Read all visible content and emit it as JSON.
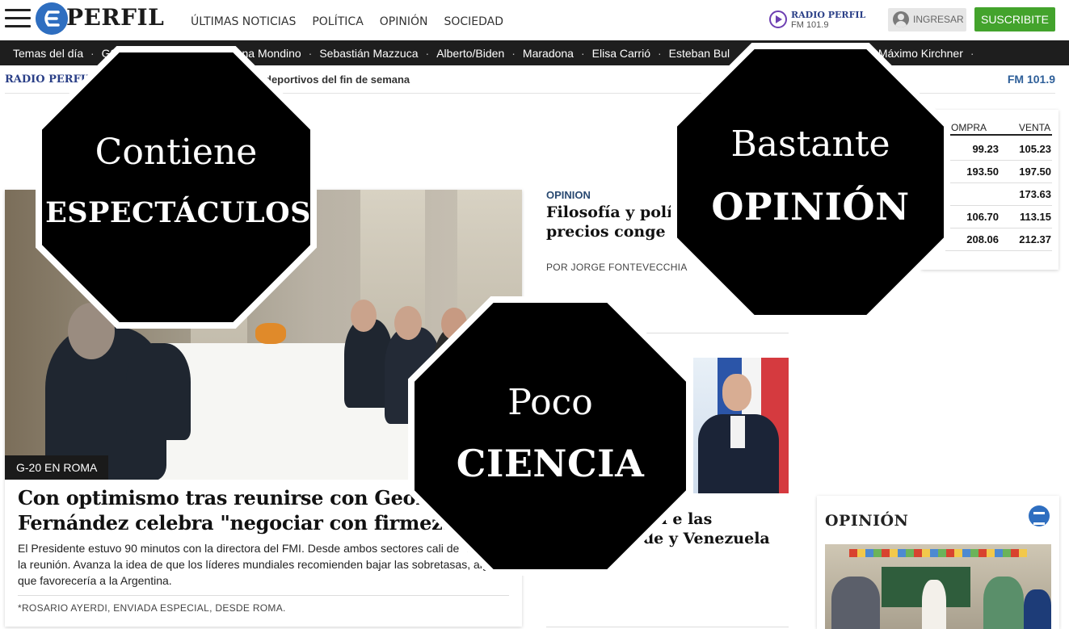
{
  "header": {
    "logo_text": "PERFIL",
    "nav": [
      "ÚLTIMAS NOTICIAS",
      "POLÍTICA",
      "OPINIÓN",
      "SOCIEDAD"
    ],
    "radio": {
      "name": "RADIO PERFIL",
      "frequency": "FM 101.9"
    },
    "login_label": "INGRESAR",
    "subscribe_label": "SUSCRIBITE"
  },
  "trending": {
    "label": "Temas del día",
    "items": [
      "G20",
      "",
      "Diana Mondino",
      "Sebastián Mazzuca",
      "Alberto/Biden",
      "Maradona",
      "Elisa Carrió",
      "Esteban Bul",
      "Máximo Kirchner"
    ]
  },
  "radio_strip": {
    "brand": "RADIO PERFIL",
    "program": "deportivos del fin de semana",
    "frequency": "FM 101.9"
  },
  "lead": {
    "tag": "G-20 EN ROMA",
    "title": "Con optimismo tras reunirse con Georgieva, A Fernández celebra \"negociar con firmeza\"",
    "summary": "El Presidente estuvo 90 minutos con la directora del FMI. Desde ambos sectores cali de \"buena\" la reunión. Avanza la idea de que los líderes mundiales recomienden bajar las sobretasas, algo que favorecería a la Argentina.",
    "byline": "*ROSARIO AYERDI, ENVIADA ESPECIAL, DESDE ROMA."
  },
  "opinion_article": {
    "section": "OPINION",
    "headline": "Filosofía y polític los precios conge",
    "byline": "POR JORGE FONTEVECCHIA"
  },
  "macron_article": {
    "headline": "que habló con e las dictaduras de y Venezuela"
  },
  "currency": {
    "col_buy": "OMPRA",
    "col_sell": "VENTA",
    "rows": [
      {
        "buy": "99.23",
        "sell": "105.23"
      },
      {
        "buy": "193.50",
        "sell": "197.50"
      },
      {
        "buy": "",
        "sell": "173.63"
      },
      {
        "buy": "106.70",
        "sell": "113.15"
      },
      {
        "buy": "208.06",
        "sell": "212.37"
      }
    ]
  },
  "opinion_widget": {
    "title": "OPINIÓN"
  },
  "stickers": [
    {
      "line1": "Contiene",
      "line2": "ESPECTÁCULOS"
    },
    {
      "line1": "Bastante",
      "line2": "OPINIÓN"
    },
    {
      "line1": "Poco",
      "line2": "CIENCIA"
    }
  ],
  "colors": {
    "brand_blue": "#2e6ec0",
    "subscribe_green": "#43a32c",
    "trending_bg": "#1e1e1e",
    "radio_purple": "#6d3fb2",
    "sticker_fill": "#000000"
  },
  "icons": {
    "menu": "hamburger-icon",
    "logo": "perfil-logo-icon",
    "radio": "play-circle-icon",
    "login": "user-avatar-icon"
  }
}
